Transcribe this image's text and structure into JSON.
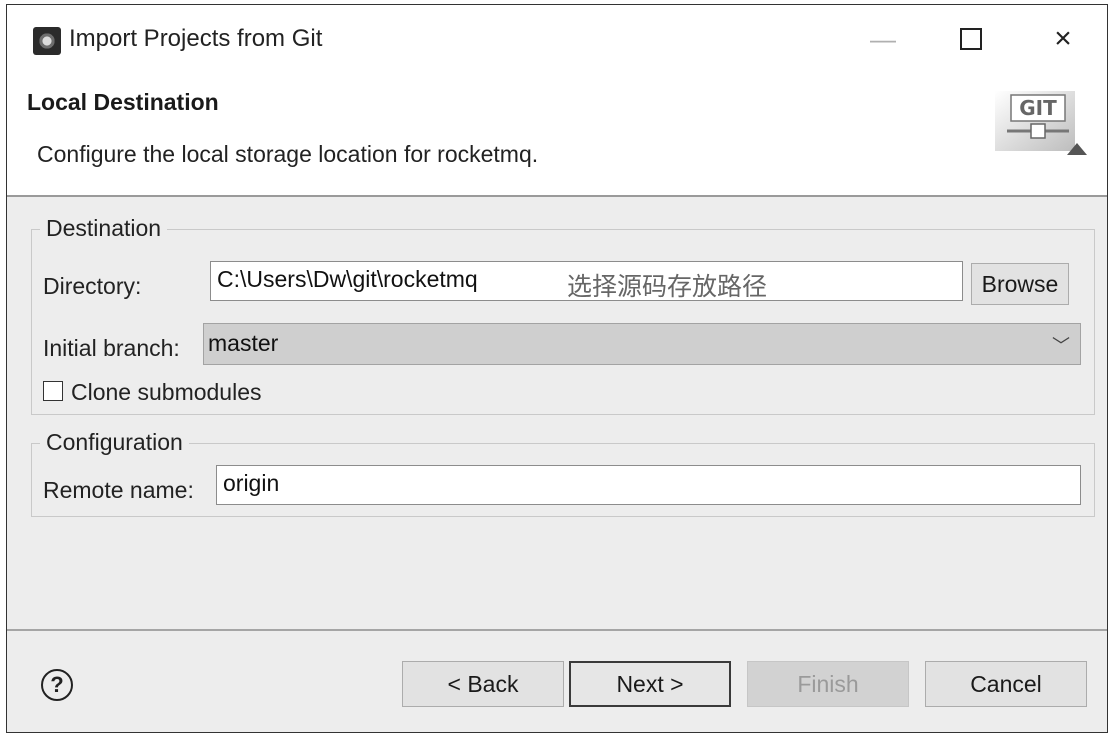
{
  "window": {
    "title": "Import Projects from Git",
    "controls": {
      "minimize": "—",
      "maximize": "",
      "close": "×"
    }
  },
  "header": {
    "title": "Local Destination",
    "description": "Configure the local storage location for rocketmq.",
    "logo_text": "GIT"
  },
  "destination": {
    "legend": "Destination",
    "directory_label": "Directory:",
    "directory_value": "C:\\Users\\Dw\\git\\rocketmq",
    "annotation": "选择源码存放路径",
    "browse_label": "Browse",
    "branch_label": "Initial branch:",
    "branch_value": "master",
    "clone_submodules_label": "Clone submodules",
    "clone_submodules_checked": false
  },
  "configuration": {
    "legend": "Configuration",
    "remote_label": "Remote name:",
    "remote_value": "origin"
  },
  "footer": {
    "help": "?",
    "back_label": "< Back",
    "next_label": "Next >",
    "finish_label": "Finish",
    "cancel_label": "Cancel"
  }
}
